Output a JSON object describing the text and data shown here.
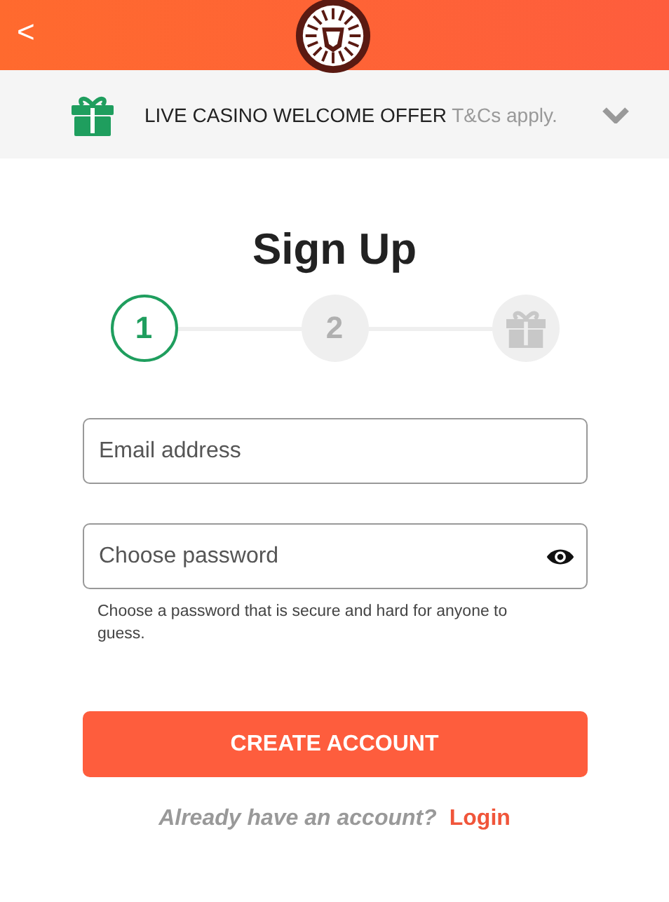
{
  "header": {
    "back": "<"
  },
  "offer": {
    "title": "LIVE CASINO WELCOME OFFER",
    "terms": "T&Cs apply.",
    "expanded": false
  },
  "title": "Sign Up",
  "steps": [
    {
      "kind": "number",
      "label": "1",
      "selected": true
    },
    {
      "kind": "number",
      "label": "2",
      "selected": false
    },
    {
      "kind": "gift",
      "selected": false
    }
  ],
  "fields": [
    {
      "kind": "text",
      "placeholder": "Email address"
    },
    {
      "kind": "password",
      "placeholder": "Choose password",
      "hint": "Choose a password that is secure and hard for anyone to guess."
    }
  ],
  "button": "CREATE ACCOUNT",
  "login": {
    "question": "Already have an account?",
    "link": "Login"
  }
}
